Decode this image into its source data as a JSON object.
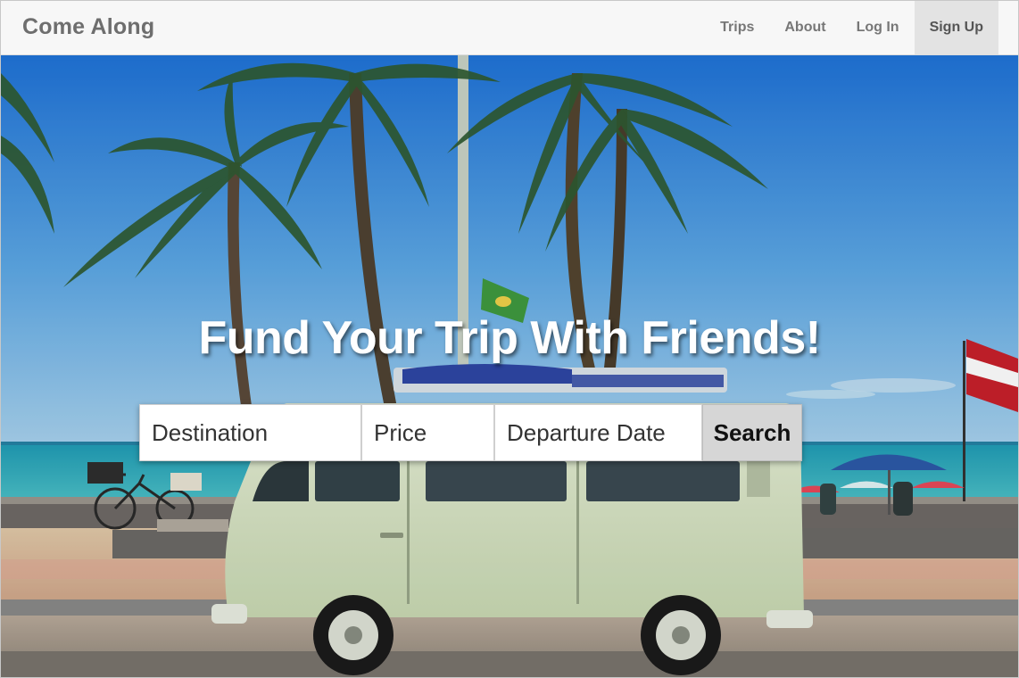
{
  "navbar": {
    "brand": "Come Along",
    "links": [
      {
        "label": "Trips"
      },
      {
        "label": "About"
      },
      {
        "label": "Log In"
      },
      {
        "label": "Sign Up",
        "active": true
      }
    ]
  },
  "hero": {
    "headline": "Fund Your Trip With Friends!",
    "search": {
      "destination_placeholder": "Destination",
      "price_placeholder": "Price",
      "date_placeholder": "Departure Date",
      "button_label": "Search"
    }
  },
  "colors": {
    "navbar_bg": "#f7f7f7",
    "brand_text": "#6e6e6e",
    "active_link_bg": "#e3e3e3",
    "search_button_bg": "#d6d6d6"
  }
}
